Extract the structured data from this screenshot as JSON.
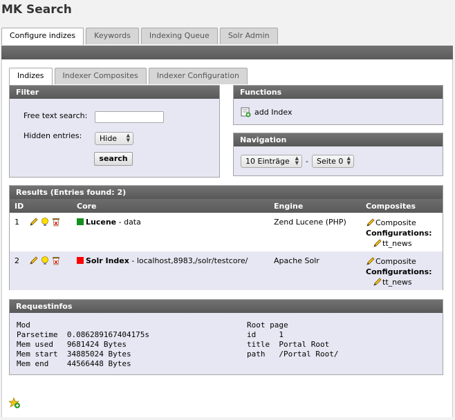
{
  "app": {
    "title": "MK Search"
  },
  "main_tabs": [
    "Configure indizes",
    "Keywords",
    "Indexing Queue",
    "Solr Admin"
  ],
  "sub_tabs": [
    "Indizes",
    "Indexer Composites",
    "Indexer Configuration"
  ],
  "filter": {
    "title": "Filter",
    "free_text_label": "Free text search:",
    "free_text_value": "",
    "hidden_label": "Hidden entries:",
    "hidden_value": "Hide",
    "search_button": "search"
  },
  "functions": {
    "title": "Functions",
    "add_index": "add Index"
  },
  "navigation": {
    "title": "Navigation",
    "per_page": "10 Einträge",
    "separator": "-",
    "page": "Seite 0"
  },
  "results": {
    "title": "Results (Entries found: 2)",
    "columns": [
      "ID",
      "Core",
      "Engine",
      "Composites"
    ],
    "rows": [
      {
        "id": "1",
        "color": "#13901e",
        "name": "Lucene",
        "detail": " - data",
        "engine": "Zend Lucene (PHP)",
        "composite": "Composite",
        "config_label": "Configurations:",
        "config": "tt_news"
      },
      {
        "id": "2",
        "color": "#ff0000",
        "name": "Solr Index",
        "detail": " - localhost,8983,/solr/testcore/",
        "engine": "Apache Solr",
        "composite": "Composite",
        "config_label": "Configurations:",
        "config": "tt_news"
      }
    ]
  },
  "requestinfos": {
    "title": "Requestinfos",
    "left": "Mod\nParsetime  0.086289167404175s\nMem used   9681424 Bytes\nMem start  34885024 Bytes\nMem end    44566448 Bytes",
    "right": "Root page\nid     1\ntitle  Portal Root\npath   /Portal Root/"
  },
  "icons": [
    "pencil-icon",
    "lightbulb-icon",
    "delete-icon",
    "add-index-icon",
    "add-bookmark-icon"
  ]
}
